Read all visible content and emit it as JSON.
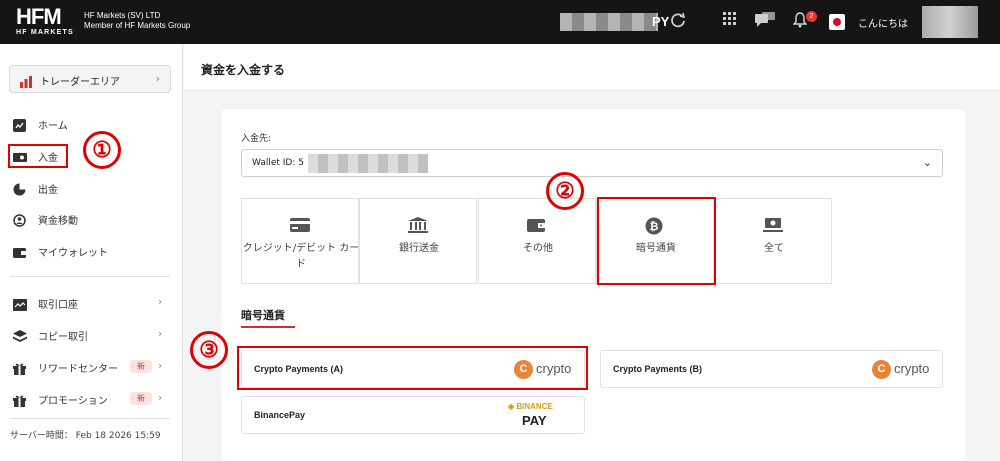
{
  "header": {
    "logo_main": "HFM",
    "logo_sub": "HF MARKETS",
    "entity_line1": "HF Markets (SV) LTD",
    "entity_line2": "Member of HF Markets Group",
    "currency_fragment": "PY",
    "notification_count": "2",
    "greeting": "こんにちは",
    "icons": [
      "refresh-icon",
      "apps-grid-icon",
      "chat-icon",
      "bell-icon",
      "japan-flag-icon"
    ]
  },
  "sidebar": {
    "trader_area": "トレーダーエリア",
    "items": [
      {
        "label": "ホーム",
        "icon": "chart-icon"
      },
      {
        "label": "入金",
        "icon": "deposit-icon"
      },
      {
        "label": "出金",
        "icon": "withdraw-icon"
      },
      {
        "label": "資金移動",
        "icon": "transfer-icon"
      },
      {
        "label": "マイウォレット",
        "icon": "wallet-icon"
      },
      {
        "label": "取引口座",
        "icon": "trading-account-icon"
      },
      {
        "label": "コピー取引",
        "icon": "layers-icon"
      },
      {
        "label": "リワードセンター",
        "icon": "gift-icon",
        "badge": "新"
      },
      {
        "label": "プロモーション",
        "icon": "gift-icon",
        "badge": "新"
      }
    ],
    "server_time": "サーバー時間： Feb 18 2026 15:59"
  },
  "main": {
    "title": "資金を入金する",
    "destination_label": "入金先:",
    "wallet_prefix": "Wallet ID: 5",
    "methods": [
      {
        "label": "クレジット/デビット カード",
        "icon": "credit-card-icon"
      },
      {
        "label": "銀行送金",
        "icon": "bank-icon"
      },
      {
        "label": "その他",
        "icon": "wallet-icon"
      },
      {
        "label": "暗号通貨",
        "icon": "bitcoin-icon"
      },
      {
        "label": "全て",
        "icon": "cash-icon"
      }
    ],
    "section_title": "暗号通貨",
    "payments": [
      {
        "name": "Crypto Payments (A)",
        "logo": "crypto"
      },
      {
        "name": "Crypto Payments (B)",
        "logo": "crypto"
      },
      {
        "name": "BinancePay",
        "logo_top": "◈ BINANCE",
        "logo_bottom": "PAY"
      }
    ]
  },
  "annotations": [
    "①",
    "②",
    "③"
  ],
  "colors": {
    "accent": "#d32f2f",
    "annotation": "#e00000",
    "header_bg": "#151515",
    "crypto_orange": "#e8833a"
  }
}
